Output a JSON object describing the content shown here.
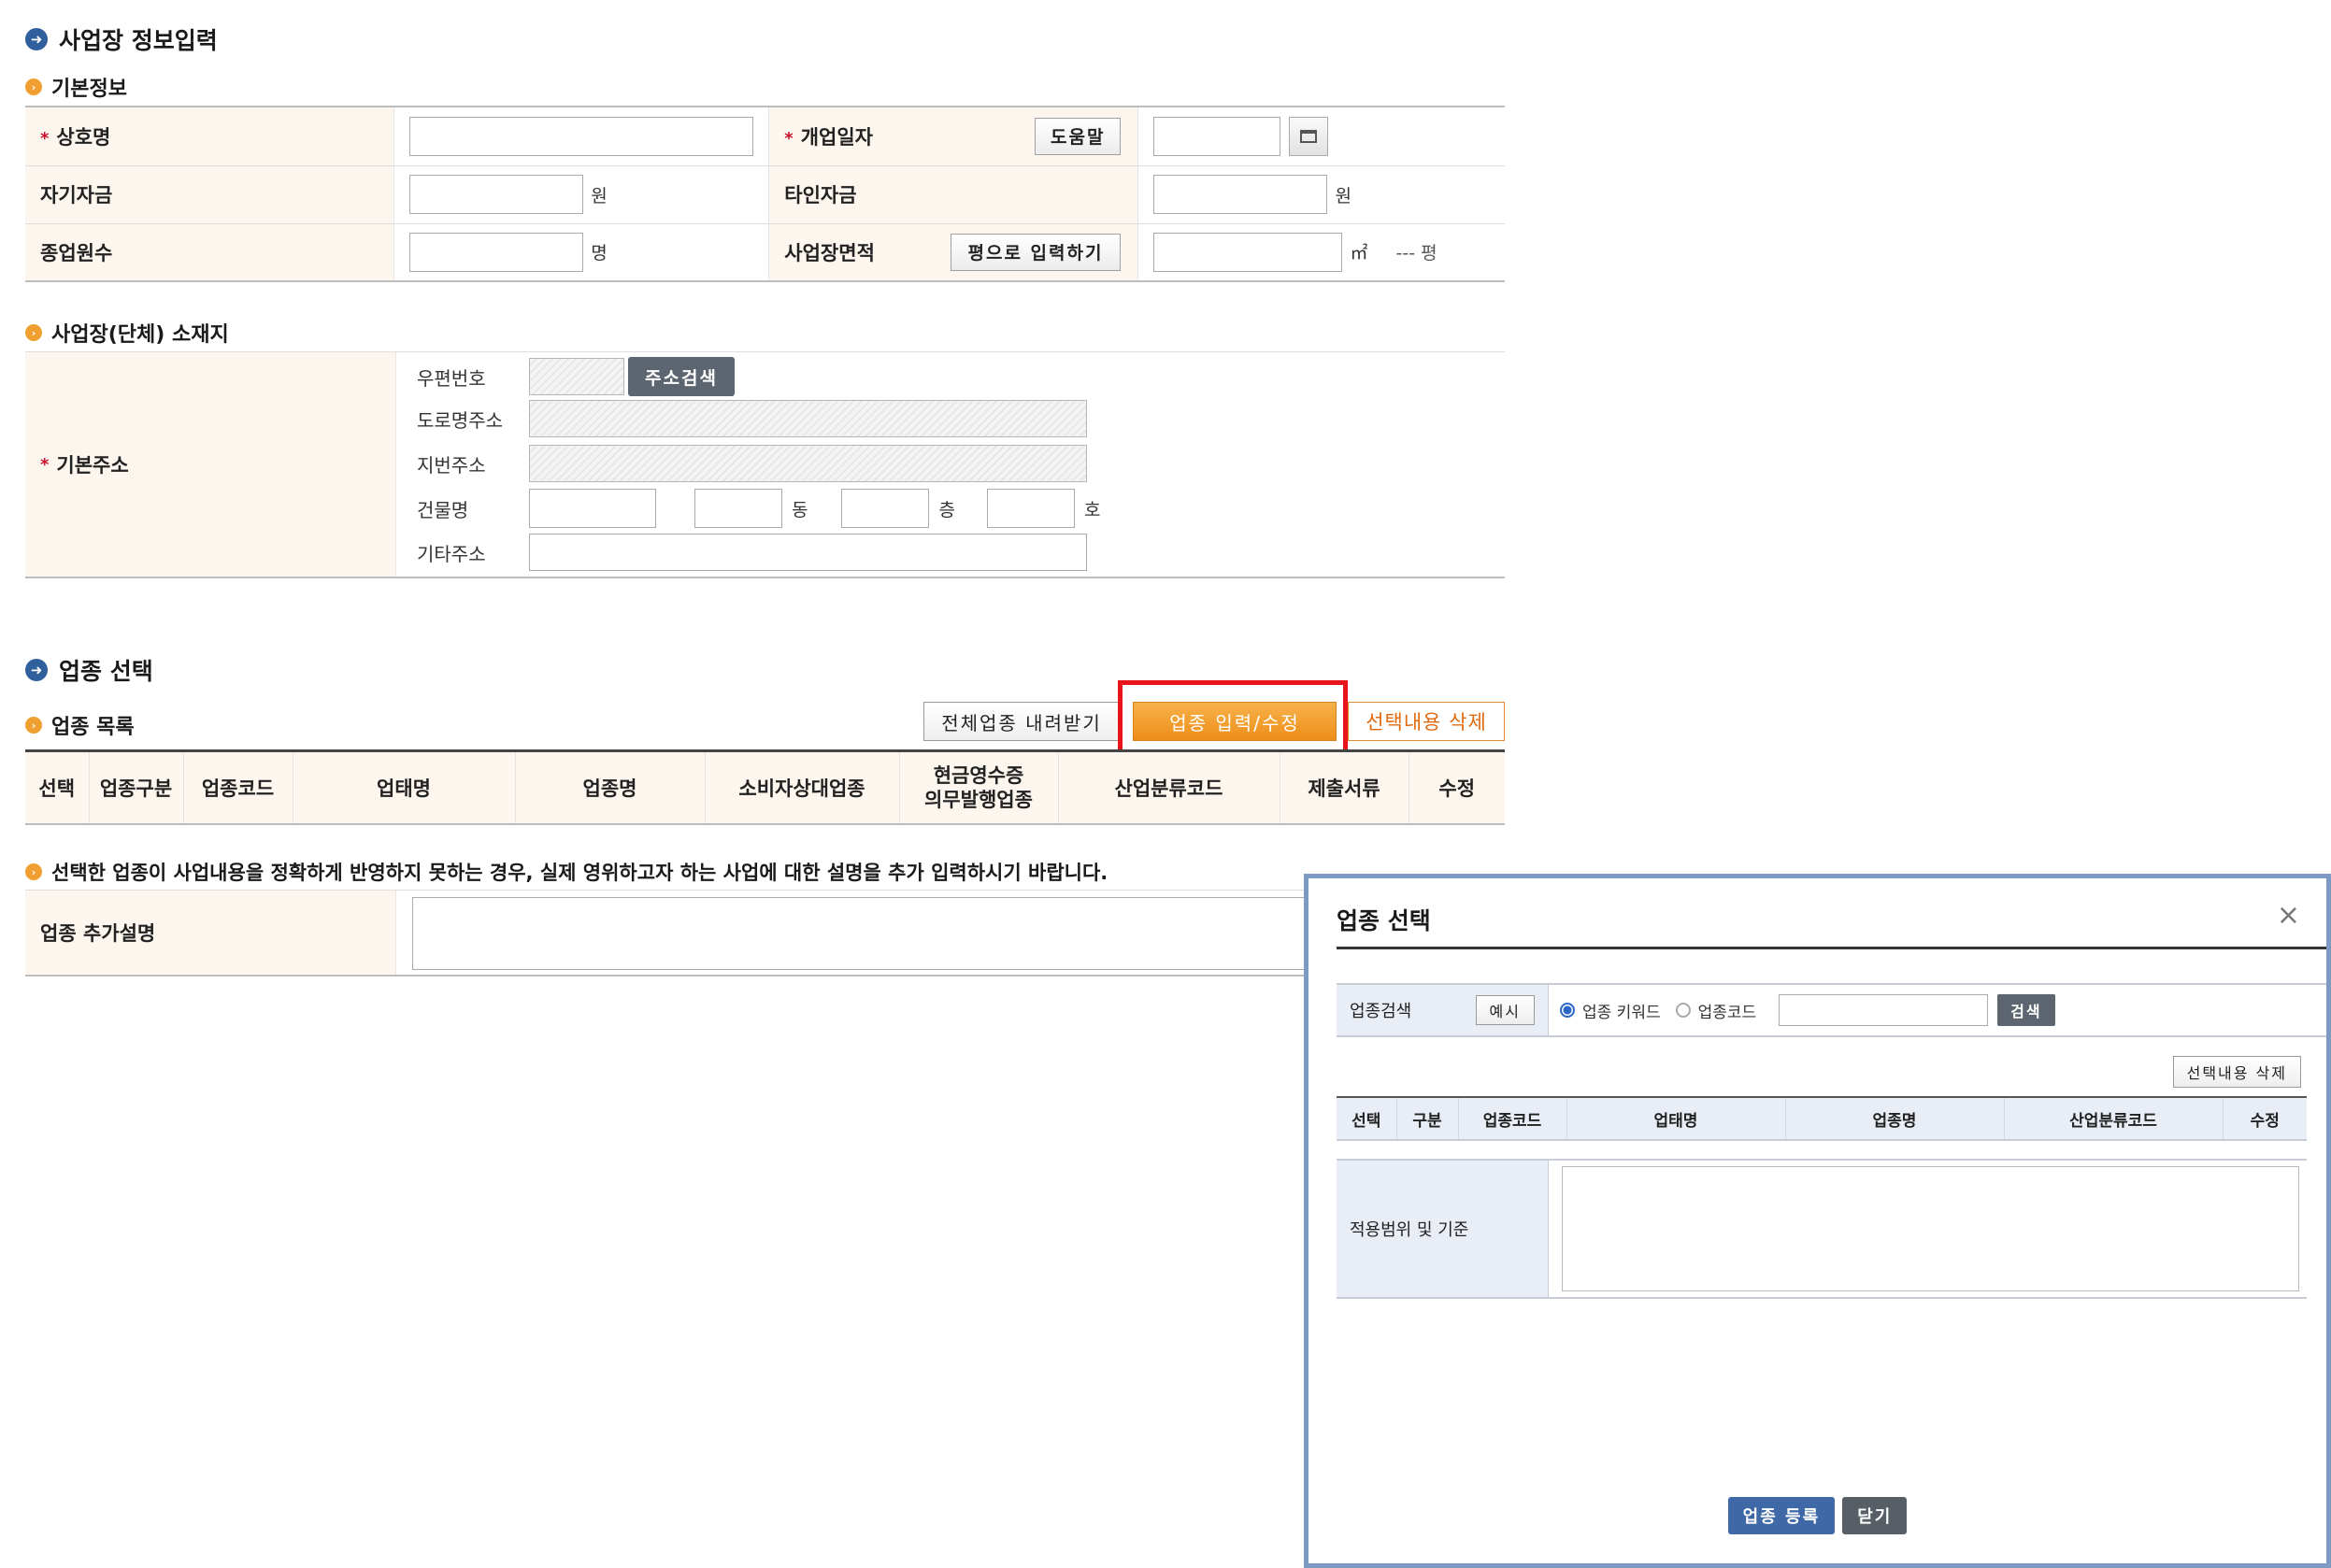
{
  "page": {
    "title": "사업장 정보입력",
    "basic_section": "기본정보",
    "location_section": "사업장(단체) 소재지",
    "industry_title": "업종 선택",
    "industry_list_label": "업종 목록",
    "notice": "선택한 업종이 사업내용을 정확하게 반영하지 못하는 경우, 실제 영위하고자 하는 사업에 대한 설명을 추가 입력하시기 바랍니다."
  },
  "basic": {
    "business_name_label": "상호명",
    "open_date_label": "개업일자",
    "help_button": "도움말",
    "own_capital_label": "자기자금",
    "other_capital_label": "타인자금",
    "won_unit": "원",
    "employees_label": "종업원수",
    "person_unit": "명",
    "area_label": "사업장면적",
    "pyeong_button": "평으로 입력하기",
    "sqm_unit": "㎡",
    "pyeong_display": "--- 평"
  },
  "address": {
    "label": "기본주소",
    "postcode_label": "우편번호",
    "search_button": "주소검색",
    "road_label": "도로명주소",
    "lot_label": "지번주소",
    "building_label": "건물명",
    "dong_unit": "동",
    "floor_unit": "층",
    "ho_unit": "호",
    "etc_label": "기타주소"
  },
  "industry": {
    "download_button": "전체업종 내려받기",
    "edit_button": "업종 입력/수정",
    "delete_button": "선택내용 삭제",
    "columns": [
      "선택",
      "업종구분",
      "업종코드",
      "업태명",
      "업종명",
      "소비자상대업종",
      "현금영수증\n의무발행업종",
      "산업분류코드",
      "제출서류",
      "수정"
    ],
    "extra_label": "업종 추가설명"
  },
  "modal": {
    "title": "업종 선택",
    "close_glyph": "×",
    "search_label": "업종검색",
    "example_button": "예시",
    "radio_keyword": "업종 키워드",
    "radio_code": "업종코드",
    "search_button": "검색",
    "delete_button": "선택내용 삭제",
    "columns": [
      "선택",
      "구분",
      "업종코드",
      "업태명",
      "업종명",
      "산업분류코드",
      "수정"
    ],
    "criteria_label": "적용범위 및 기준",
    "register_button": "업종 등록",
    "close_button": "닫기"
  },
  "colors": {
    "highlight": "#e8141c",
    "accent_orange": "#ee8e19",
    "modal_border": "#7f9ac2"
  }
}
